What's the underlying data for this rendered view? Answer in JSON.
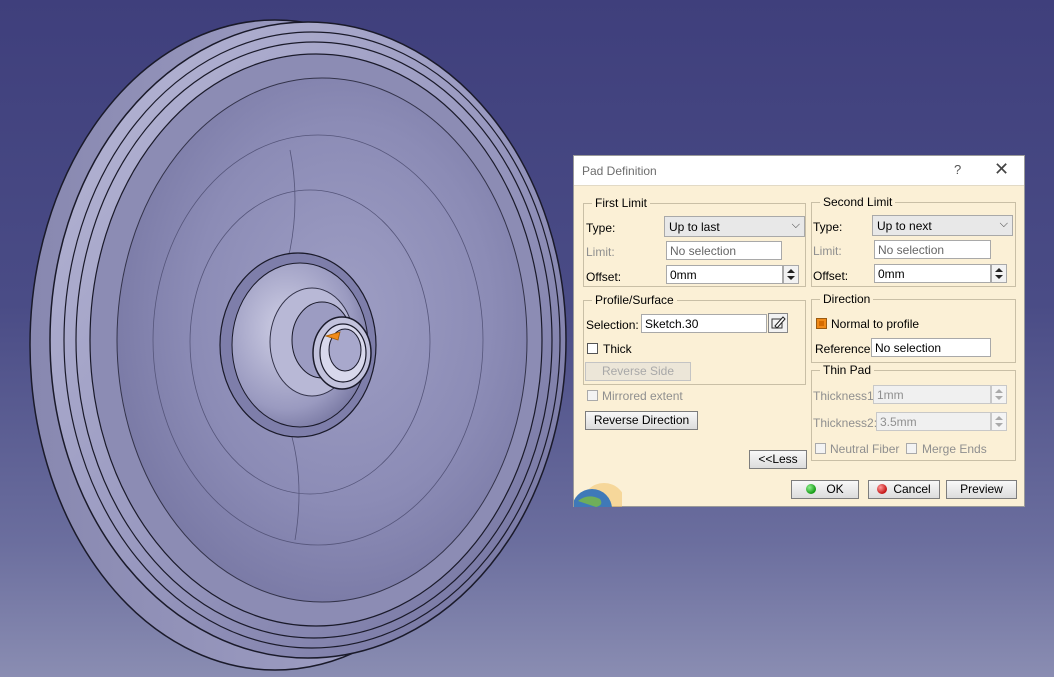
{
  "dialog": {
    "title": "Pad Definition",
    "help_glyph": "?",
    "close_glyph": "✕",
    "first_limit": {
      "legend": "First Limit",
      "type_label": "Type:",
      "type_value": "Up to last",
      "limit_label": "Limit:",
      "limit_value": "No selection",
      "offset_label": "Offset:",
      "offset_value": "0mm"
    },
    "second_limit": {
      "legend": "Second Limit",
      "type_label": "Type:",
      "type_value": "Up to next",
      "limit_label": "Limit:",
      "limit_value": "No selection",
      "offset_label": "Offset:",
      "offset_value": "0mm"
    },
    "profile": {
      "legend": "Profile/Surface",
      "selection_label": "Selection:",
      "selection_value": "Sketch.30",
      "thick_label": "Thick",
      "reverse_side_label": "Reverse Side"
    },
    "mirrored_extent_label": "Mirrored extent",
    "reverse_direction_label": "Reverse Direction",
    "less_label": "<<Less",
    "direction": {
      "legend": "Direction",
      "normal_label": "Normal to profile",
      "reference_label": "Reference:",
      "reference_value": "No selection"
    },
    "thin_pad": {
      "legend": "Thin Pad",
      "thickness1_label": "Thickness1:",
      "thickness1_value": "1mm",
      "thickness2_label": "Thickness2:",
      "thickness2_value": "3.5mm",
      "neutral_fiber_label": "Neutral Fiber",
      "merge_ends_label": "Merge Ends"
    },
    "ok_label": "OK",
    "cancel_label": "Cancel",
    "preview_label": "Preview"
  },
  "colors": {
    "viewport_top": "#3f3f7c",
    "viewport_bottom": "#8a8db2",
    "dialog_bg": "#fbf0d6",
    "part_surface": "#9b9bc2",
    "accent": "#f08a18"
  }
}
